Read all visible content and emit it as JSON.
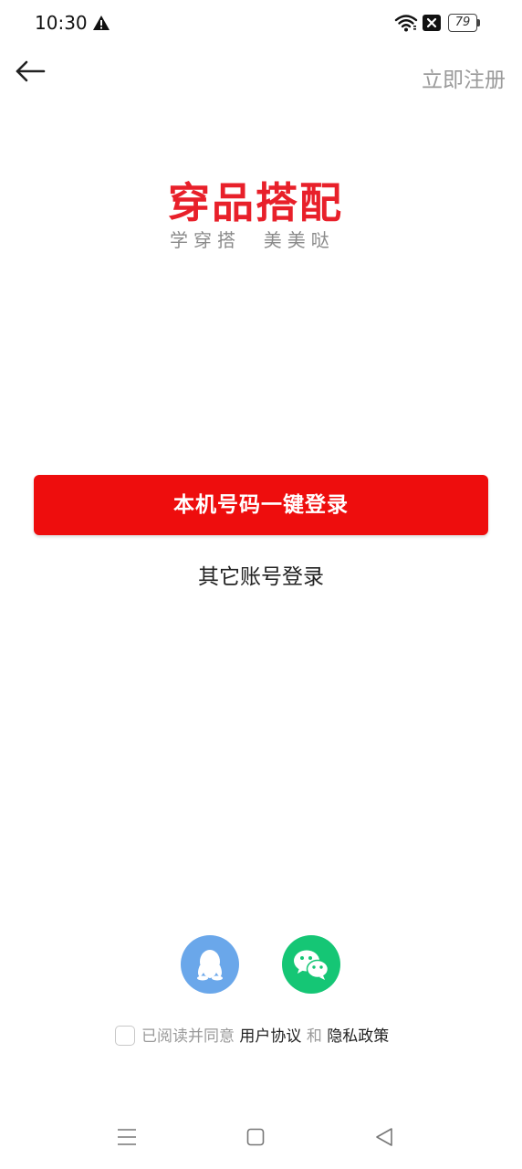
{
  "status_bar": {
    "time": "10:30",
    "battery_level": "79",
    "icons": [
      "warning-icon",
      "wifi-icon",
      "sim-icon",
      "battery-icon"
    ]
  },
  "header": {
    "back_icon": "arrow-left-icon",
    "register_label": "立即注册"
  },
  "logo": {
    "title": "穿品搭配",
    "slogan": "学穿搭  美美哒"
  },
  "login": {
    "one_click_label": "本机号码一键登录",
    "other_account_label": "其它账号登录"
  },
  "social": {
    "qq_icon": "qq-penguin-icon",
    "wechat_icon": "wechat-icon"
  },
  "agreement": {
    "prefix": "已阅读并同意",
    "user_agreement": "用户协议",
    "and": "和",
    "privacy_policy": "隐私政策"
  },
  "nav_bar": {
    "icons": [
      "menu-icon",
      "home-square-icon",
      "back-triangle-icon"
    ]
  },
  "colors": {
    "brand_red": "#ee0d0d",
    "logo_red": "#e8202a",
    "qq_blue": "#6aa7ea",
    "wechat_green": "#15c675",
    "muted_text": "#9a9a9a"
  }
}
